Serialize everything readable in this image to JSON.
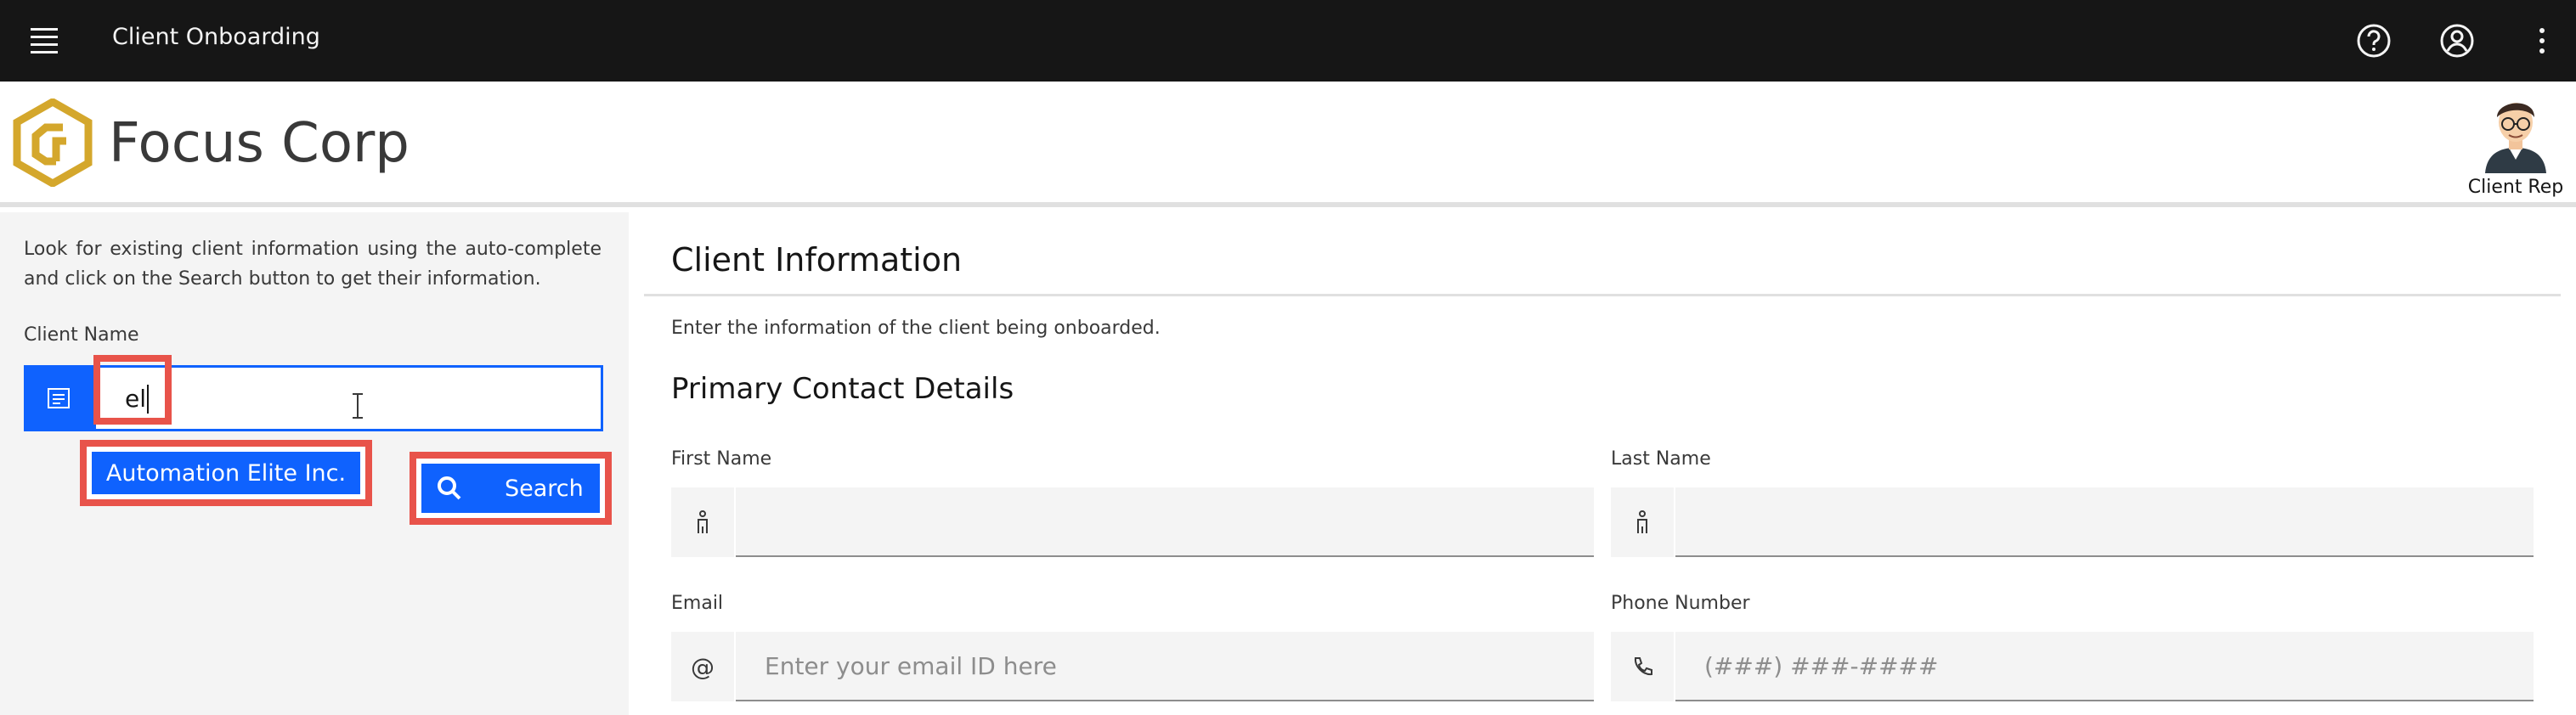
{
  "header": {
    "app_title": "Client Onboarding",
    "icons": [
      "menu-icon",
      "help-icon",
      "user-profile-icon",
      "overflow-menu-icon"
    ],
    "background": "#161616"
  },
  "brand": {
    "name": "Focus Corp",
    "logo_color": "#d4a72c",
    "rep_label": "Client Rep"
  },
  "left_panel": {
    "intro": "Look for existing client information using the auto-complete and click on the Search button to get their information.",
    "client_name_label": "Client Name",
    "client_name_value": "el",
    "suggestion": "Automation Elite Inc.",
    "search_label": "Search"
  },
  "main": {
    "section_title": "Client Information",
    "section_desc": "Enter the information of the client being onboarded.",
    "subsection_title": "Primary Contact Details",
    "fields": {
      "first_name": {
        "label": "First Name",
        "placeholder": ""
      },
      "last_name": {
        "label": "Last Name",
        "placeholder": ""
      },
      "email": {
        "label": "Email",
        "placeholder": "Enter your email ID here",
        "icon_text": "@"
      },
      "phone": {
        "label": "Phone Number",
        "placeholder": "(###) ###-####"
      }
    }
  },
  "colors": {
    "accent": "#0f62fe",
    "highlight": "#e8534a",
    "panel_bg": "#f4f4f4"
  }
}
